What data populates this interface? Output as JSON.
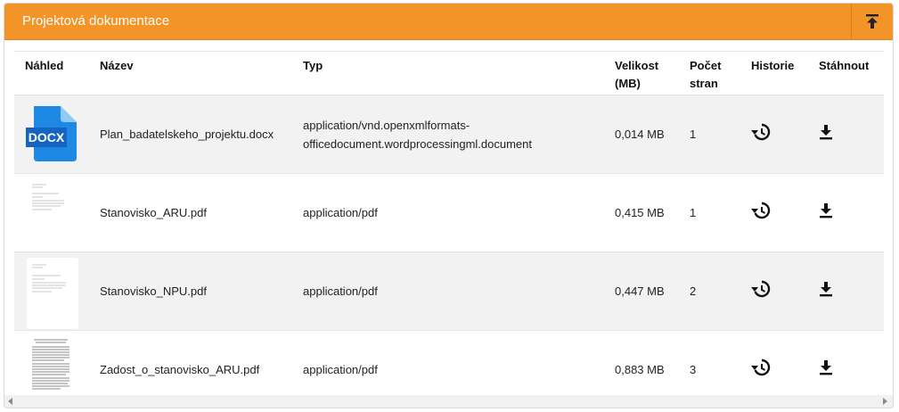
{
  "panel": {
    "title": "Projektová dokumentace"
  },
  "table": {
    "headers": {
      "preview": "Náhled",
      "name": "Název",
      "type": "Typ",
      "size_line1": "Velikost",
      "size_line2": "(MB)",
      "pages_line1": "Počet",
      "pages_line2": "stran",
      "history": "Historie",
      "download": "Stáhnout"
    },
    "rows": [
      {
        "preview": "DOCX",
        "name": "Plan_badatelskeho_projektu.docx",
        "type_line1": "application/vnd.openxmlformats-",
        "type_line2": "officedocument.wordprocessingml.document",
        "size": "0,014 MB",
        "pages": "1"
      },
      {
        "name": "Stanovisko_ARU.pdf",
        "type_line1": "application/pdf",
        "type_line2": "",
        "size": "0,415 MB",
        "pages": "1"
      },
      {
        "name": "Stanovisko_NPU.pdf",
        "type_line1": "application/pdf",
        "type_line2": "",
        "size": "0,447 MB",
        "pages": "2"
      },
      {
        "name": "Zadost_o_stanovisko_ARU.pdf",
        "type_line1": "application/pdf",
        "type_line2": "",
        "size": "0,883 MB",
        "pages": "3"
      }
    ]
  },
  "colors": {
    "header_bg": "#f29427",
    "docx_blue": "#1e88e5"
  },
  "icons": {
    "collapse": "collapse-up-icon",
    "history": "history-icon",
    "download": "download-icon"
  }
}
